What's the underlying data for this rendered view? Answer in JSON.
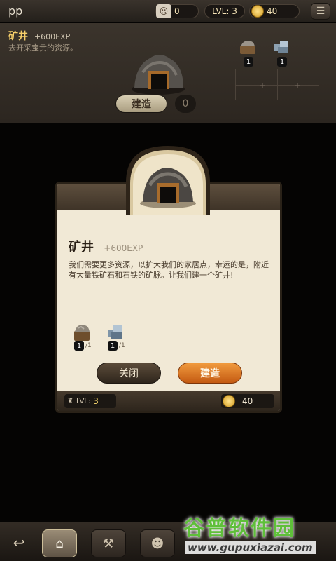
{
  "top": {
    "player_name": "pp",
    "workers": "0",
    "level": "LVL: 3",
    "coins": "40",
    "worker_icon": "worker-icon",
    "coin_icon": "coin-icon",
    "menu_icon": "menu-icon"
  },
  "info": {
    "title": "矿井",
    "exp": "+600EXP",
    "description": "去开采宝贵的资源。",
    "build_label": "建造",
    "count": "0",
    "req_counts": [
      "1",
      "1"
    ],
    "mine_icon": "mine-icon"
  },
  "dialog": {
    "title": "矿井",
    "exp": "+600EXP",
    "description": "我们需要更多资源，以扩大我们的家居点，幸运的是，附近有大量铁矿石和石铁的矿脉。让我们建一个矿井!",
    "requirements": [
      {
        "icon": "stone-ore-icon",
        "have": "1",
        "need": "/1"
      },
      {
        "icon": "iron-ore-icon",
        "have": "1",
        "need": "/1"
      }
    ],
    "close_label": "关闭",
    "build_label": "建造",
    "level_label": "LVL:",
    "level_value": "3",
    "cost": "40"
  },
  "bottom": {
    "back_icon": "back-arrow-icon",
    "home_icon": "home-icon",
    "build_icon": "hammer-icon",
    "people_icon": "people-icon"
  },
  "watermark": {
    "title": "谷普软件园",
    "url": "www.gupuxiazai.com"
  },
  "colors": {
    "accent_orange": "#e07a2a",
    "gold_text": "#f6cf6a",
    "parchment": "#f1e9d6"
  }
}
